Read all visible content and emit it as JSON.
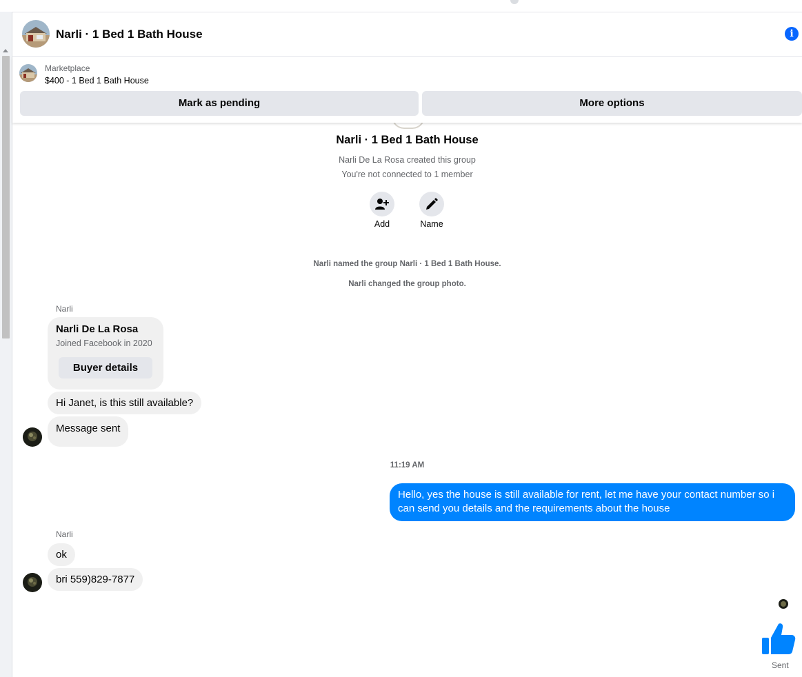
{
  "header": {
    "title": "Narli · 1 Bed 1 Bath House"
  },
  "marketplace": {
    "label": "Marketplace",
    "price_title": "$400 - 1 Bed 1 Bath House",
    "mark_pending": "Mark as pending",
    "more_options": "More options"
  },
  "chat_intro": {
    "group_name": "Narli · 1 Bed 1 Bath House",
    "created": "Narli De La Rosa created this group",
    "connected": "You're not connected to 1 member",
    "add_label": "Add",
    "name_label": "Name"
  },
  "system": {
    "named": "Narli named the group Narli · 1 Bed 1 Bath House.",
    "photo": "Narli changed the group photo."
  },
  "messages": {
    "sender1": "Narli",
    "card_name": "Narli De La Rosa",
    "card_joined": "Joined Facebook in 2020",
    "buyer_details": "Buyer details",
    "msg1": "Hi Janet, is this still available?",
    "msg2": "Message sent",
    "timestamp": "11:19 AM",
    "reply": "Hello, yes the house is still available for rent, let me have your contact number so i can send you details and the requirements about the house",
    "sender2": "Narli",
    "msg3": "ok",
    "msg4": "bri 559)829-7877",
    "sent_status": "Sent"
  },
  "colors": {
    "accent": "#0084ff",
    "bubble_in": "#f0f0f0",
    "secondary_text": "#65676b"
  }
}
